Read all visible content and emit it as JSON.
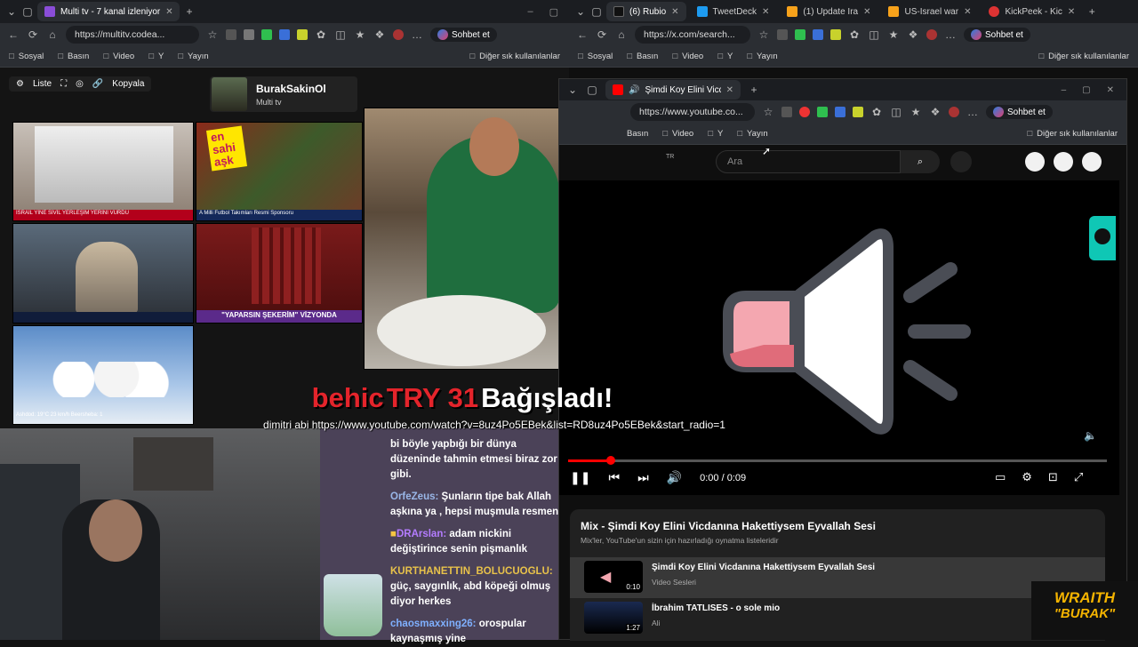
{
  "left_browser": {
    "tabs": [
      {
        "label": "Multi tv - 7 kanal izleniyor",
        "active": true
      }
    ],
    "url": "https://multitv.codea...",
    "chat_button": "Sohbet et",
    "bookmarks": [
      "Sosyal",
      "Basın",
      "Video",
      "Y",
      "Yayın"
    ],
    "bookmarks_other": "Diğer sık kullanılanlar"
  },
  "right_browser": {
    "tabs": [
      {
        "label": "(6) Rubio",
        "color": "#111"
      },
      {
        "label": "TweetDeck",
        "color": "#1d9bf0"
      },
      {
        "label": "(1) Update Ira",
        "color": "#f7a21b"
      },
      {
        "label": "US-Israel war",
        "color": "#f7a21b"
      },
      {
        "label": "KickPeek - Kic",
        "color": "#d33"
      }
    ],
    "url": "https://x.com/search...",
    "chat_button": "Sohbet et",
    "bookmarks": [
      "Sosyal",
      "Basın",
      "Video",
      "Y",
      "Yayın"
    ],
    "bookmarks_other": "Diğer sık kullanılanlar"
  },
  "multitv": {
    "toolbar": {
      "list": "Liste",
      "copy": "Kopyala"
    },
    "channel_name": "BurakSakinOl",
    "channel_sub": "Multi tv",
    "tiles": {
      "t1_ticker": "İSRAİL YİNE SİVİL YERLEŞİM YERİNİ VURDU",
      "t2_overlay": "en sahi aşk",
      "t2_ticker": "A Milli Futbol Takımları Resmi Sponsoru",
      "t4_ticker": "\"YAPARSIN ŞEKERİM\" VİZYONDA",
      "t5_ticker": "Ashdod: 19°C  23 km/h  Beersheba: 1"
    }
  },
  "donation": {
    "user": "behic",
    "amount": "TRY 31",
    "verb": "Bağışladı!",
    "message": "dimitri abi https://www.youtube.com/watch?v=8uz4Po5EBek&list=RD8uz4Po5EBek&start_radio=1"
  },
  "chat": [
    {
      "user": "",
      "color": "#fff",
      "text": "bi böyle yapbığı bir dünya düzeninde tahmin etmesi biraz zor gibi."
    },
    {
      "user": "OrfeZeus:",
      "color": "#9ab7e8",
      "text": "Şunların tipe bak Allah aşkına ya , hepsi muşmula resmen"
    },
    {
      "user": "DRArslan:",
      "color": "#b47cff",
      "text": "adam nickini değiştirince senin pişmanlık"
    },
    {
      "user": "KURTHANETTIN_BOLUCUOGLU:",
      "color": "#e8c24a",
      "text": "güç, saygınlık, abd köpeği olmuş diyor herkes"
    },
    {
      "user": "chaosmaxxing26:",
      "color": "#7fb0ff",
      "text": "orospular kaynaşmış yine"
    }
  ],
  "youtube_window": {
    "tab": "Şimdi Koy Elini Vicdanına Hak",
    "url": "https://www.youtube.co...",
    "chat_button": "Sohbet et",
    "bookmarks": [
      "Basın",
      "Video",
      "Y",
      "Yayın"
    ],
    "bookmarks_other": "Diğer sık kullanılanlar",
    "region": "TR",
    "search_placeholder": "Ara",
    "time": "0:00 / 0:09",
    "progress": 0.08,
    "mix_title": "Mix - Şimdi Koy Elini Vicdanına Hakettiysem Eyvallah Sesi",
    "mix_sub": "Mix'ler, YouTube'un sizin için hazırladığı oynatma listeleridir",
    "playlist": [
      {
        "title": "Şimdi Koy Elini Vicdanına Hakettiysem Eyvallah Sesi",
        "channel": "Video Sesleri",
        "duration": "0:10"
      },
      {
        "title": "İbrahim TATLISES - o sole mio",
        "channel": "Ali",
        "duration": "1:27"
      }
    ]
  },
  "overlay_logo": {
    "line1": "WRAITH",
    "line2": "\"BURAK\""
  }
}
